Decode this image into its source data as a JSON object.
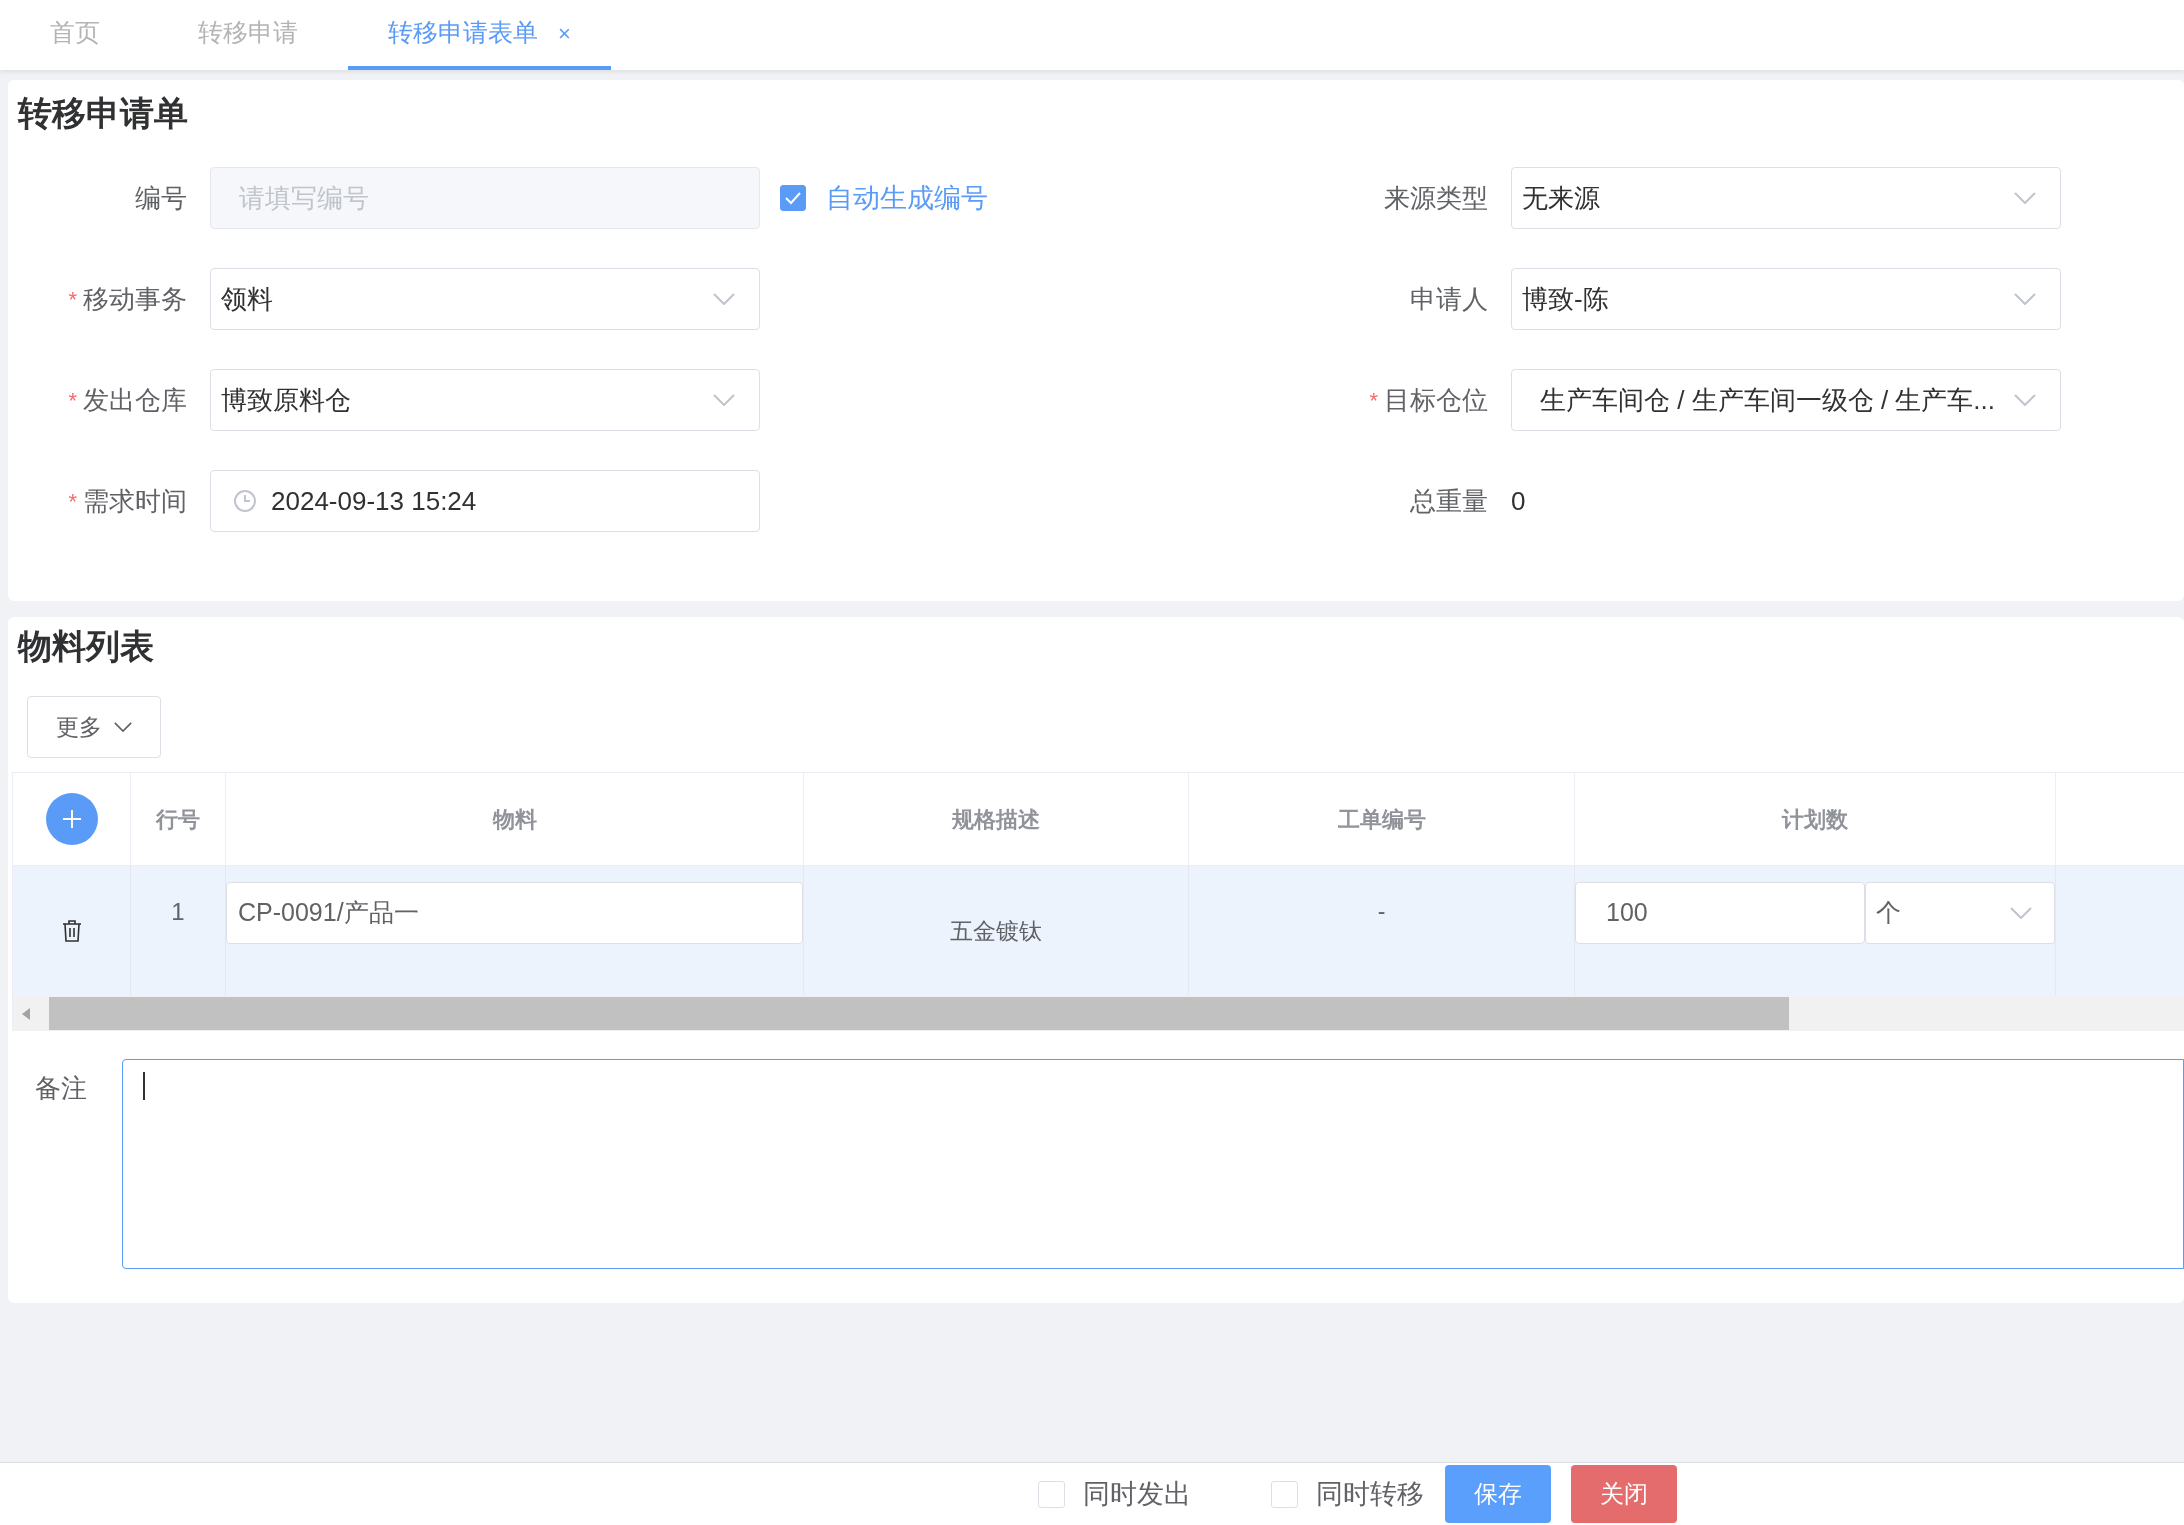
{
  "tabs": [
    {
      "label": "首页",
      "selected": false
    },
    {
      "label": "转移申请",
      "selected": false
    },
    {
      "label": "转移申请表单",
      "selected": true,
      "close": "×"
    }
  ],
  "form": {
    "title": "转移申请单",
    "left": [
      {
        "kind": "input",
        "label": "编号",
        "placeholder": "请填写编号",
        "disabled": true,
        "checkbox": {
          "label": "自动生成编号",
          "checked": true
        }
      },
      {
        "kind": "select",
        "label": "移动事务",
        "required_mark": "*",
        "value": "领料"
      },
      {
        "kind": "select",
        "label": "发出仓库",
        "required_mark": "*",
        "value": "博致原料仓"
      },
      {
        "kind": "date",
        "label": "需求时间",
        "required_mark": "*",
        "value": "2024-09-13 15:24"
      }
    ],
    "right": [
      {
        "kind": "select",
        "label": "来源类型",
        "value": "无来源"
      },
      {
        "kind": "select",
        "label": "申请人",
        "value": "博致-陈"
      },
      {
        "kind": "cascader",
        "label": "目标仓位",
        "required_mark": "*",
        "value": "生产车间仓 / 生产车间一级仓 / 生产车..."
      },
      {
        "kind": "text",
        "label": "总重量",
        "value": "0"
      }
    ]
  },
  "materials": {
    "title": "物料列表",
    "more_button": "更多",
    "columns": [
      "行号",
      "物料",
      "规格描述",
      "工单编号",
      "计划数"
    ],
    "rows": [
      {
        "line": "1",
        "material": "CP-0091/产品一",
        "spec": "五金镀钛",
        "work_order": "-",
        "quantity": "100",
        "unit": "个",
        "selected": true
      }
    ]
  },
  "remark": {
    "label": "备注"
  },
  "footer": {
    "options": [
      {
        "label": "同时发出",
        "checked": false
      },
      {
        "label": "同时转移",
        "checked": false
      }
    ],
    "buttons": [
      {
        "label": "保存",
        "kind": "primary"
      },
      {
        "label": "关闭",
        "kind": "danger"
      }
    ]
  }
}
